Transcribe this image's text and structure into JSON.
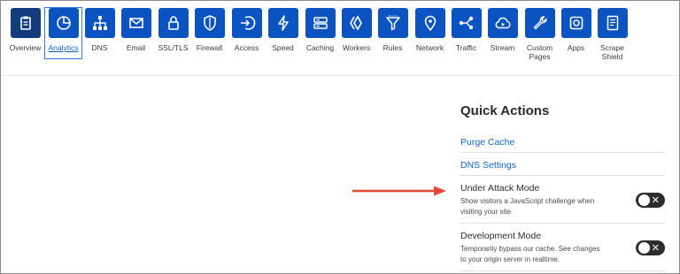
{
  "nav": {
    "items": [
      {
        "label": "Overview",
        "icon": "clipboard-icon"
      },
      {
        "label": "Analytics",
        "icon": "pie-chart-icon"
      },
      {
        "label": "DNS",
        "icon": "network-tree-icon"
      },
      {
        "label": "Email",
        "icon": "envelope-icon"
      },
      {
        "label": "SSL/TLS",
        "icon": "lock-icon"
      },
      {
        "label": "Firewall",
        "icon": "shield-icon"
      },
      {
        "label": "Access",
        "icon": "login-arrow-icon"
      },
      {
        "label": "Speed",
        "icon": "lightning-icon"
      },
      {
        "label": "Caching",
        "icon": "server-stack-icon"
      },
      {
        "label": "Workers",
        "icon": "workers-icon"
      },
      {
        "label": "Rules",
        "icon": "filter-icon"
      },
      {
        "label": "Network",
        "icon": "location-pin-icon"
      },
      {
        "label": "Traffic",
        "icon": "share-nodes-icon"
      },
      {
        "label": "Stream",
        "icon": "cloud-play-icon"
      },
      {
        "label": "Custom Pages",
        "icon": "wrench-icon"
      },
      {
        "label": "Apps",
        "icon": "apps-icon"
      },
      {
        "label": "Scrape Shield",
        "icon": "document-icon"
      }
    ],
    "selected": "Overview",
    "active": "Analytics",
    "tile_color": "#0b53c1",
    "selected_tile_color": "#123c7c"
  },
  "quick_actions": {
    "title": "Quick Actions",
    "links": [
      "Purge Cache",
      "DNS Settings"
    ],
    "toggles": [
      {
        "title": "Under Attack Mode",
        "description": "Show visitors a JavaScript challenge when visiting your site.",
        "enabled": false
      },
      {
        "title": "Development Mode",
        "description": "Temporarily bypass our cache. See changes to your origin server in realtime.",
        "enabled": false
      }
    ]
  },
  "annotation": {
    "type": "arrow",
    "color": "#e0463a",
    "points_to": "Under Attack Mode"
  }
}
